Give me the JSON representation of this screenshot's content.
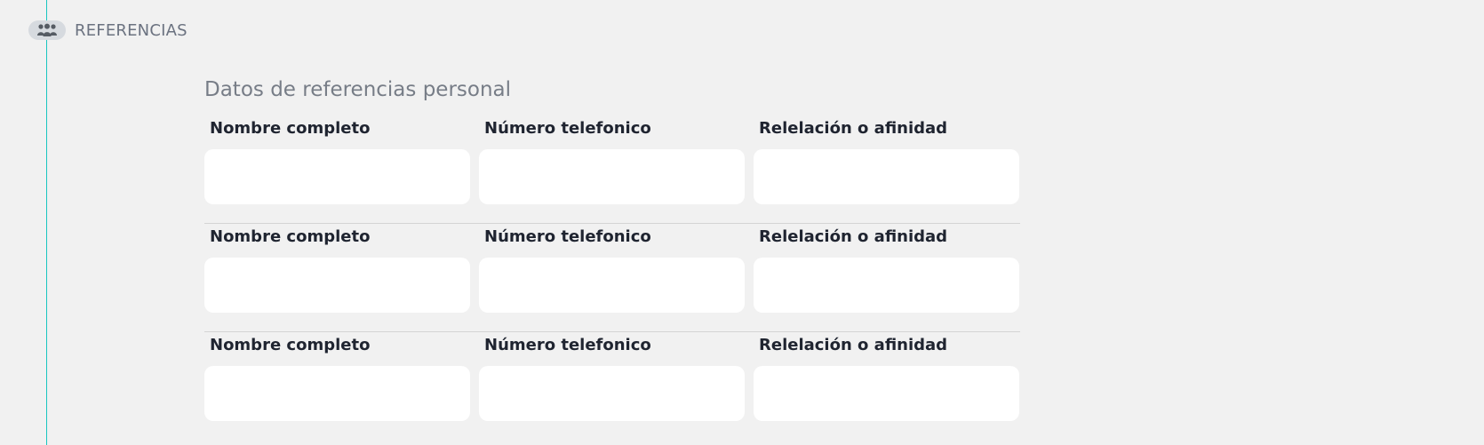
{
  "section": {
    "title": "REFERENCIAS",
    "icon": "people-group-icon"
  },
  "group": {
    "title": "Datos de referencias personal"
  },
  "references": [
    {
      "name_label": "Nombre completo",
      "name_value": "",
      "phone_label": "Número telefonico",
      "phone_value": "",
      "relation_label": "Relelación o afinidad",
      "relation_value": ""
    },
    {
      "name_label": "Nombre completo",
      "name_value": "",
      "phone_label": "Número telefonico",
      "phone_value": "",
      "relation_label": "Relelación o afinidad",
      "relation_value": ""
    },
    {
      "name_label": "Nombre completo",
      "name_value": "",
      "phone_label": "Número telefonico",
      "phone_value": "",
      "relation_label": "Relelación o afinidad",
      "relation_value": ""
    }
  ],
  "colors": {
    "background": "#f1f1f1",
    "timeline": "#19c6c0",
    "label": "#1f2430",
    "muted": "#777d87",
    "input_bg": "#ffffff"
  }
}
